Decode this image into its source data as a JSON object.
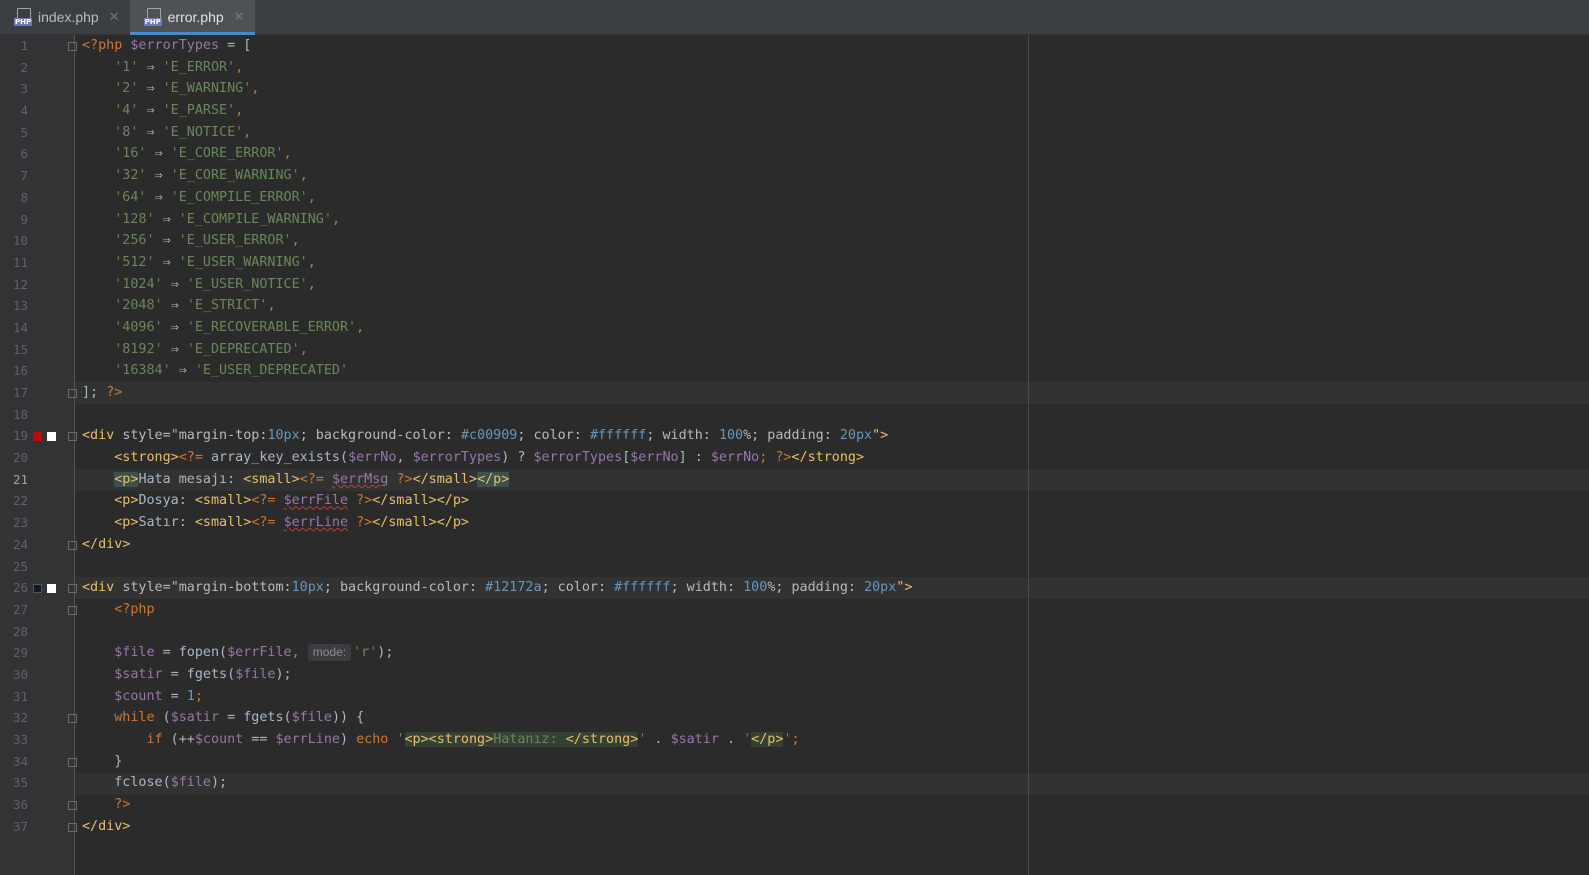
{
  "tabs": [
    {
      "label": "index.php",
      "icon": "php-file-icon",
      "active": false
    },
    {
      "label": "error.php",
      "icon": "php-file-icon",
      "active": true
    }
  ],
  "icon_labels": {
    "php": "PHP",
    "close": "✕"
  },
  "editor": {
    "current_line": 21,
    "line_numbers": [
      "1",
      "2",
      "3",
      "4",
      "5",
      "6",
      "7",
      "8",
      "9",
      "10",
      "11",
      "12",
      "13",
      "14",
      "15",
      "16",
      "17",
      "18",
      "19",
      "20",
      "21",
      "22",
      "23",
      "24",
      "25",
      "26",
      "27",
      "28",
      "29",
      "30",
      "31",
      "32",
      "33",
      "34",
      "35",
      "36",
      "37"
    ],
    "code": {
      "l1": {
        "open": "<?php",
        "var": "$errorTypes",
        "rest": " = ["
      },
      "l2": {
        "key": "'1'",
        "val": "'E_ERROR'"
      },
      "l3": {
        "key": "'2'",
        "val": "'E_WARNING'"
      },
      "l4": {
        "key": "'4'",
        "val": "'E_PARSE'"
      },
      "l5": {
        "key": "'8'",
        "val": "'E_NOTICE'"
      },
      "l6": {
        "key": "'16'",
        "val": "'E_CORE_ERROR'"
      },
      "l7": {
        "key": "'32'",
        "val": "'E_CORE_WARNING'"
      },
      "l8": {
        "key": "'64'",
        "val": "'E_COMPILE_ERROR'"
      },
      "l9": {
        "key": "'128'",
        "val": "'E_COMPILE_WARNING'"
      },
      "l10": {
        "key": "'256'",
        "val": "'E_USER_ERROR'"
      },
      "l11": {
        "key": "'512'",
        "val": "'E_USER_WARNING'"
      },
      "l12": {
        "key": "'1024'",
        "val": "'E_USER_NOTICE'"
      },
      "l13": {
        "key": "'2048'",
        "val": "'E_STRICT'"
      },
      "l14": {
        "key": "'4096'",
        "val": "'E_RECOVERABLE_ERROR'"
      },
      "l15": {
        "key": "'8192'",
        "val": "'E_DEPRECATED'"
      },
      "l16": {
        "key": "'16384'",
        "val": "'E_USER_DEPRECATED'"
      },
      "arrow": "⇒",
      "comma": ",",
      "l17": {
        "bracket": "];",
        "close": "?>"
      },
      "l19": {
        "tag_open": "<div ",
        "attr": "style=",
        "q": "\"",
        "p1": "margin-top:",
        "n1": "10px",
        "p2": "; background-color: ",
        "c1": "#c00909",
        "p3": "; color: ",
        "c2": "#ffffff",
        "p4": "; width: ",
        "n2": "100",
        "p5": "%; padding: ",
        "n3": "20px",
        "end": "\">"
      },
      "l20": {
        "strong_open": "<strong>",
        "echo_open": "<?=",
        "fn": " array_key_exists(",
        "v1": "$errNo",
        "sep": ", ",
        "v2": "$errorTypes",
        "tern": ") ? ",
        "v3": "$errorTypes",
        "br1": "[",
        "v4": "$errNo",
        "br2": "] : ",
        "v5": "$errNo",
        "semi": ";",
        "php_close": " ?>",
        "strong_close": "</strong>"
      },
      "l21": {
        "p_open": "<p>",
        "text": "Hata mesajı: ",
        "small_open": "<small>",
        "echo_open": "<?=",
        "v": "$errMsg",
        "php_close": " ?>",
        "small_close": "</small>",
        "p_close": "</p>"
      },
      "l22": {
        "p_open": "<p>",
        "text": "Dosya: ",
        "small_open": "<small>",
        "echo_open": "<?=",
        "v": "$errFile",
        "php_close": " ?>",
        "small_close": "</small>",
        "p_close": "</p>"
      },
      "l23": {
        "p_open": "<p>",
        "text": "Satır: ",
        "small_open": "<small>",
        "echo_open": "<?=",
        "v": "$errLine",
        "php_close": " ?>",
        "small_close": "</small>",
        "p_close": "</p>"
      },
      "l24": {
        "tag": "</div>"
      },
      "l26": {
        "tag_open": "<div ",
        "attr": "style=",
        "q": "\"",
        "p1": "margin-bottom:",
        "n1": "10px",
        "p2": "; background-color: ",
        "c1": "#12172a",
        "p3": "; color: ",
        "c2": "#ffffff",
        "p4": "; width: ",
        "n2": "100",
        "p5": "%; padding: ",
        "n3": "20px",
        "end": "\">"
      },
      "l27": {
        "php_open": "<?php"
      },
      "l29": {
        "v1": "$file",
        "eq": " = fopen(",
        "v2": "$errFile",
        "sep": ", ",
        "hint": "mode:",
        "str": "'r'",
        "end": ");"
      },
      "l30": {
        "v1": "$satir",
        "eq": " = fgets(",
        "v2": "$file",
        "end": ");"
      },
      "l31": {
        "v1": "$count",
        "eq": " = ",
        "num": "1",
        "end": ";"
      },
      "l32": {
        "kw": "while",
        "open": " (",
        "v1": "$satir",
        "eq": " = fgets(",
        "v2": "$file",
        "end": ")) {"
      },
      "l33": {
        "kw": "if",
        "open": " (",
        "inc": "++",
        "v1": "$count",
        "eq": " == ",
        "v2": "$errLine",
        "close": ") ",
        "echo": "echo",
        "sp": " ",
        "q1": "'",
        "html1": "<p><strong>",
        "text": "Hatanız: ",
        "html2": "</strong>",
        "q2": "'",
        "dot1": " . ",
        "v3": "$satir",
        "dot2": " . ",
        "q3": "'",
        "html3": "</p>",
        "q4": "'",
        "semi": ";"
      },
      "l34": {
        "brace": "}"
      },
      "l35": {
        "fn": "fclose(",
        "v": "$file",
        "end": ");"
      },
      "l36": {
        "close": "?>"
      },
      "l37": {
        "tag": "</div>"
      }
    }
  },
  "colors": {
    "bg": "#2b2b2b",
    "gutter": "#313335",
    "swatch_red": "#c00909",
    "swatch_navy": "#12172a",
    "swatch_white": "#ffffff"
  }
}
